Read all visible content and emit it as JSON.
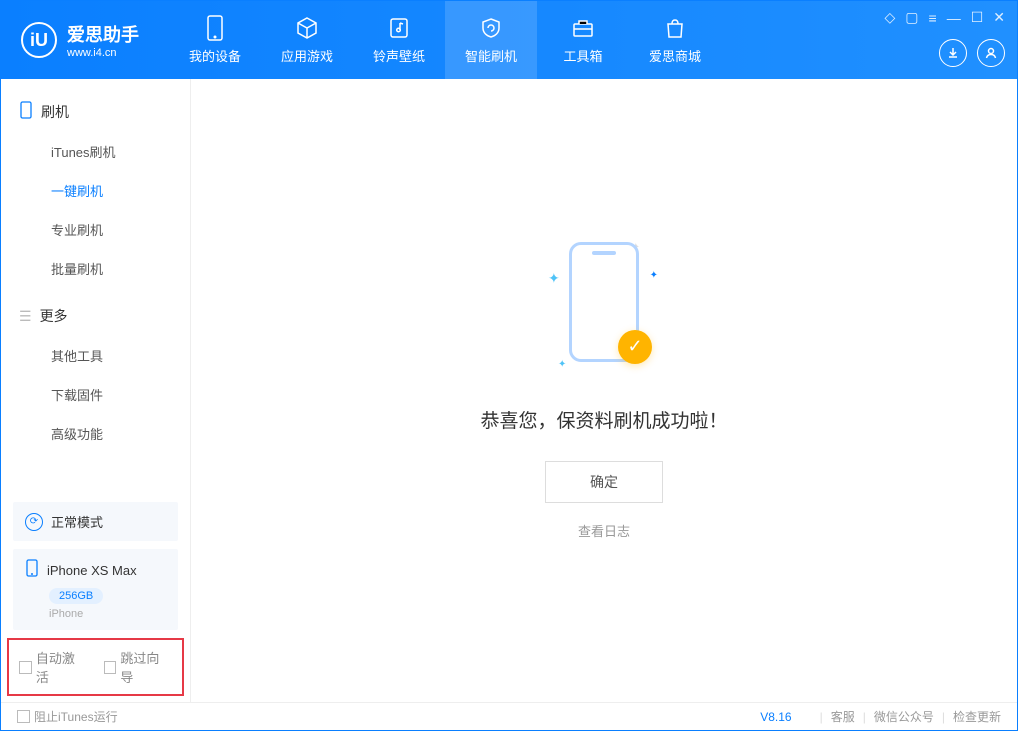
{
  "app": {
    "name": "爱思助手",
    "url": "www.i4.cn"
  },
  "nav": {
    "tabs": [
      {
        "label": "我的设备"
      },
      {
        "label": "应用游戏"
      },
      {
        "label": "铃声壁纸"
      },
      {
        "label": "智能刷机"
      },
      {
        "label": "工具箱"
      },
      {
        "label": "爱思商城"
      }
    ]
  },
  "sidebar": {
    "sections": [
      {
        "title": "刷机",
        "items": [
          {
            "label": "iTunes刷机"
          },
          {
            "label": "一键刷机",
            "active": true
          },
          {
            "label": "专业刷机"
          },
          {
            "label": "批量刷机"
          }
        ]
      },
      {
        "title": "更多",
        "items": [
          {
            "label": "其他工具"
          },
          {
            "label": "下载固件"
          },
          {
            "label": "高级功能"
          }
        ]
      }
    ],
    "mode": "正常模式",
    "device": {
      "name": "iPhone XS Max",
      "storage": "256GB",
      "type": "iPhone"
    },
    "checkboxes": {
      "auto_activate": "自动激活",
      "skip_guide": "跳过向导"
    }
  },
  "main": {
    "success_msg": "恭喜您，保资料刷机成功啦！",
    "ok": "确定",
    "view_log": "查看日志"
  },
  "footer": {
    "block_itunes": "阻止iTunes运行",
    "version": "V8.16",
    "links": {
      "support": "客服",
      "wechat": "微信公众号",
      "update": "检查更新"
    }
  }
}
